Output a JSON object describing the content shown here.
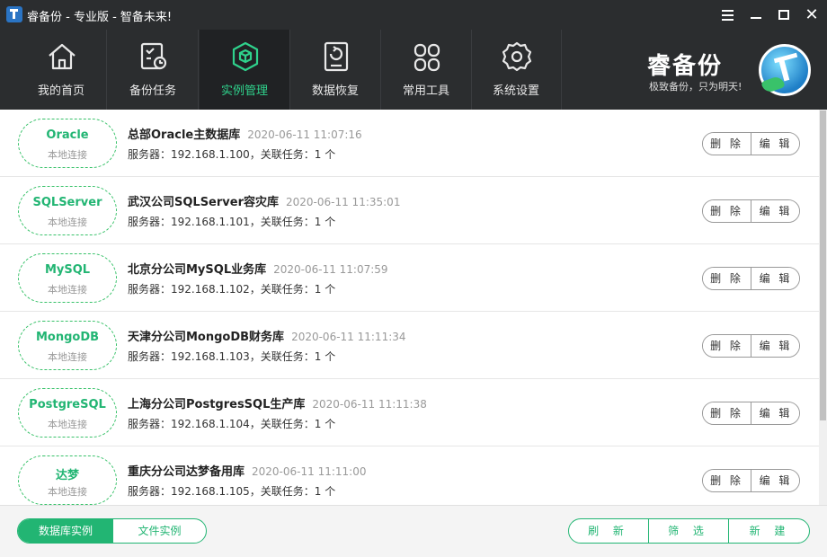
{
  "window": {
    "title": "睿备份 - 专业版 - 智备未来!"
  },
  "nav": {
    "items": [
      {
        "label": "我的首页",
        "icon": "home-icon"
      },
      {
        "label": "备份任务",
        "icon": "task-checklist-icon"
      },
      {
        "label": "实例管理",
        "icon": "cube-icon"
      },
      {
        "label": "数据恢复",
        "icon": "restore-drive-icon"
      },
      {
        "label": "常用工具",
        "icon": "tools-grid-icon"
      },
      {
        "label": "系统设置",
        "icon": "gear-icon"
      }
    ],
    "active_index": 2
  },
  "brand": {
    "name": "睿备份",
    "slogan": "极致备份，只为明天!"
  },
  "instances": [
    {
      "type": "Oracle",
      "conn": "本地连接",
      "name": "总部Oracle主数据库",
      "time": "2020-06-11 11:07:16",
      "info": "服务器：192.168.1.100，关联任务：1 个"
    },
    {
      "type": "SQLServer",
      "conn": "本地连接",
      "name": "武汉公司SQLServer容灾库",
      "time": "2020-06-11 11:35:01",
      "info": "服务器：192.168.1.101，关联任务：1 个"
    },
    {
      "type": "MySQL",
      "conn": "本地连接",
      "name": "北京分公司MySQL业务库",
      "time": "2020-06-11 11:07:59",
      "info": "服务器：192.168.1.102，关联任务：1 个"
    },
    {
      "type": "MongoDB",
      "conn": "本地连接",
      "name": "天津分公司MongoDB财务库",
      "time": "2020-06-11 11:11:34",
      "info": "服务器：192.168.1.103，关联任务：1 个"
    },
    {
      "type": "PostgreSQL",
      "conn": "本地连接",
      "name": "上海分公司PostgresSQL生产库",
      "time": "2020-06-11 11:11:38",
      "info": "服务器：192.168.1.104，关联任务：1 个"
    },
    {
      "type": "达梦",
      "conn": "本地连接",
      "name": "重庆分公司达梦备用库",
      "time": "2020-06-11 11:11:00",
      "info": "服务器：192.168.1.105，关联任务：1 个"
    }
  ],
  "row_actions": {
    "delete": "删 除",
    "edit": "编 辑"
  },
  "footer": {
    "tab_db": "数据库实例",
    "tab_file": "文件实例",
    "refresh": "刷 新",
    "filter": "筛 选",
    "create": "新 建"
  },
  "colors": {
    "accent": "#22b573",
    "dark_bg": "#2b2d2f",
    "active_nav_bg": "#202224"
  }
}
